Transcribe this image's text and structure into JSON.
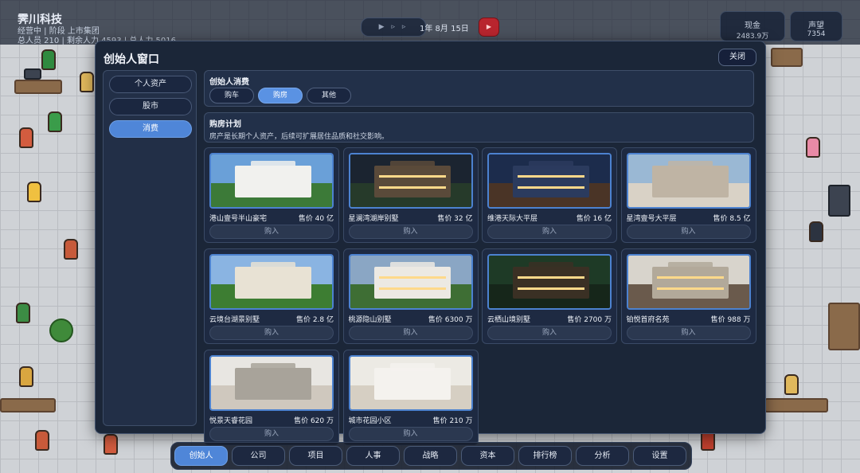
{
  "company": {
    "name": "霁川科技",
    "status": "经营中 | 阶段 上市集团",
    "staff": "总人员 210 | 剩余人力 4593 | 总人力 5016"
  },
  "topbar": {
    "play_controls": "▶ ▹ ▹",
    "date": "1年 8月 15日",
    "record_icon": "▶",
    "cash_label": "现金",
    "cash_value": "2483.9万",
    "fame_label": "声望",
    "fame_value": "7354"
  },
  "window": {
    "title": "创始人窗口",
    "close_label": "关闭"
  },
  "sidebar": {
    "items": [
      {
        "label": "个人资产"
      },
      {
        "label": "股市"
      },
      {
        "label": "消费"
      }
    ],
    "active_index": 2
  },
  "spending": {
    "title": "创始人消费",
    "tabs": [
      {
        "label": "购车"
      },
      {
        "label": "购房"
      },
      {
        "label": "其他"
      }
    ],
    "active_index": 1
  },
  "plan": {
    "title": "购房计划",
    "description": "房产是长期个人资产，后续可扩展居住品质和社交影响。"
  },
  "buy_label": "购入",
  "properties": [
    {
      "name": "港山壹号半山豪宅",
      "price": "售价 40 亿",
      "scene": "mansion-day"
    },
    {
      "name": "星澜湾湖岸别墅",
      "price": "售价 32 亿",
      "scene": "villa-night"
    },
    {
      "name": "维港天际大平层",
      "price": "售价 16 亿",
      "scene": "city-view"
    },
    {
      "name": "星湾壹号大平层",
      "price": "售价 8.5 亿",
      "scene": "living-ocean"
    },
    {
      "name": "云境台湖景别墅",
      "price": "售价 2.8 亿",
      "scene": "garden-villa"
    },
    {
      "name": "桃源隐山别墅",
      "price": "售价 6300 万",
      "scene": "hillside-villa"
    },
    {
      "name": "云栖山境别墅",
      "price": "售价 2700 万",
      "scene": "forest-villa"
    },
    {
      "name": "铂悦首府名苑",
      "price": "售价 988 万",
      "scene": "loft-interior"
    },
    {
      "name": "悦景天睿花园",
      "price": "售价 620 万",
      "scene": "bright-living"
    },
    {
      "name": "城市花园小区",
      "price": "售价 210 万",
      "scene": "apartment"
    }
  ],
  "bottom_nav": {
    "items": [
      {
        "label": "创始人"
      },
      {
        "label": "公司"
      },
      {
        "label": "项目"
      },
      {
        "label": "人事"
      },
      {
        "label": "战略"
      },
      {
        "label": "资本"
      },
      {
        "label": "排行榜"
      },
      {
        "label": "分析"
      },
      {
        "label": "设置"
      }
    ],
    "active_index": 0
  }
}
